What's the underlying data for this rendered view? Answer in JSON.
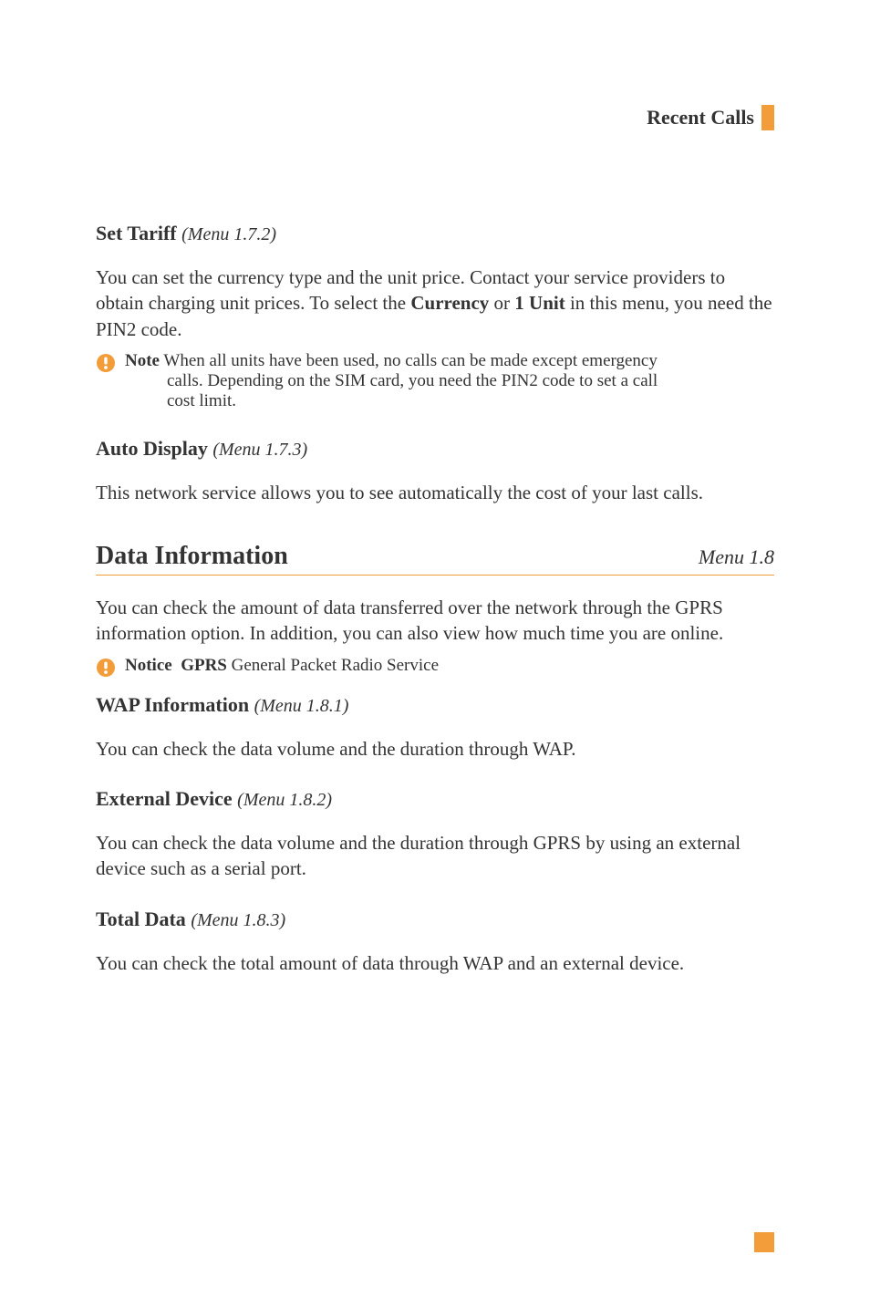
{
  "header": {
    "title": "Recent Calls"
  },
  "sections": {
    "setTariff": {
      "heading": "Set Tariff",
      "menuRef": "(Menu 1.7.2)",
      "para_a": "You can set the currency type and the unit price. Contact your service providers to obtain charging unit prices. To select the ",
      "bold1": "Currency",
      "para_b": " or ",
      "bold2": "1 Unit",
      "para_c": " in this menu, you need the PIN2 code."
    },
    "note1": {
      "label": "Note",
      "text_a": "When all units have been used, no calls can be made except emergency",
      "text_b": "calls. Depending on the SIM card, you need the PIN2 code to set a call",
      "text_c": "cost limit."
    },
    "autoDisplay": {
      "heading": "Auto Display",
      "menuRef": "(Menu 1.7.3)",
      "para": "This network service allows you to see automatically the cost of your last calls."
    },
    "dataInfo": {
      "heading": "Data Information",
      "menuRef": "Menu 1.8",
      "para": "You can check the amount of data transferred over the network through the GPRS information option. In addition, you can also view how much time you are online."
    },
    "notice1": {
      "label": "Notice",
      "gprsBold": "GPRS",
      "text": " General Packet Radio Service"
    },
    "wapInfo": {
      "heading": "WAP Information",
      "menuRef": "(Menu 1.8.1)",
      "para": "You can check the data volume and the duration through WAP."
    },
    "extDevice": {
      "heading": "External Device",
      "menuRef": "(Menu 1.8.2)",
      "para": "You can check the data volume and the duration through GPRS by using an external device such as a serial port."
    },
    "totalData": {
      "heading": "Total Data",
      "menuRef": "(Menu 1.8.3)",
      "para": "You can check the total amount of data through WAP and an external device."
    }
  }
}
